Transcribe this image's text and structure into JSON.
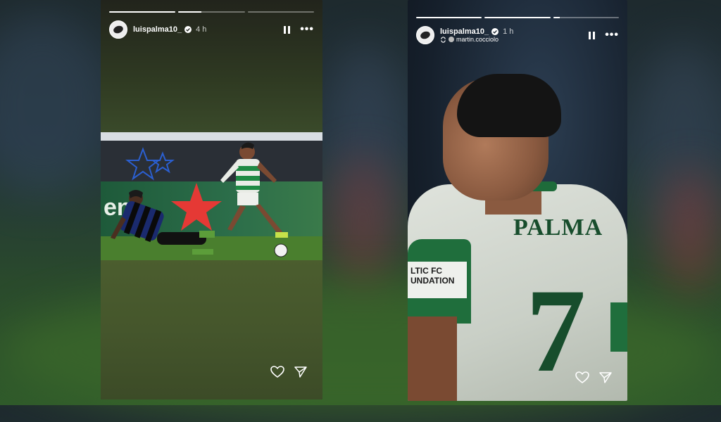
{
  "story_left": {
    "username": "luispalma10_",
    "time": "4 h",
    "progress": [
      1.0,
      0.35,
      0.0
    ],
    "photo_banner_text": "en"
  },
  "story_right": {
    "username": "luispalma10_",
    "time": "1 h",
    "reshared_from": "martin.cocciolo",
    "progress": [
      1.0,
      1.0,
      0.1
    ],
    "jersey_name": "PALMA",
    "jersey_number": "7",
    "sleeve_text": "LTIC FC UNDATION"
  },
  "colors": {
    "celtic_green": "#174d2c",
    "verified": "#3897f0",
    "ucl_star": "#e53935"
  },
  "icons": [
    "pause-icon",
    "more-icon",
    "heart-icon",
    "send-icon",
    "verified-icon",
    "repost-icon"
  ]
}
